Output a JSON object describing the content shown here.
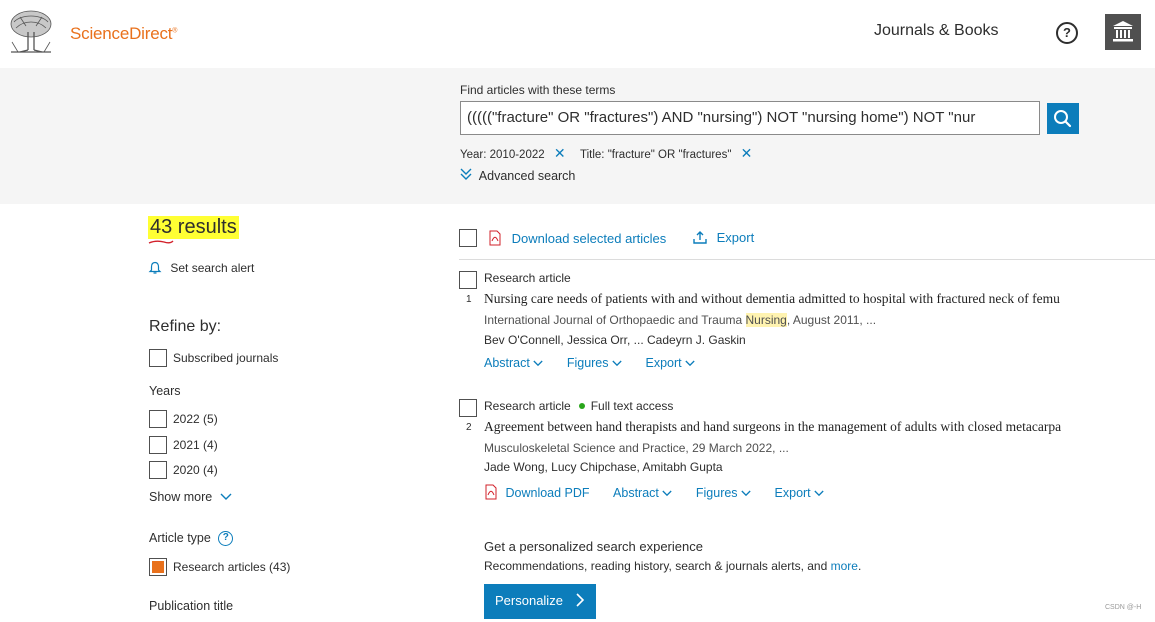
{
  "header": {
    "brand": "ScienceDirect",
    "brand_mark": "®",
    "journals_link": "Journals & Books",
    "help_icon_text": "?"
  },
  "search": {
    "find_label": "Find articles with these terms",
    "query": "(((((\"fracture\" OR \"fractures\") AND \"nursing\") NOT \"nursing home\") NOT \"nur",
    "chips": [
      {
        "label": "Year:",
        "value": "2010-2022"
      },
      {
        "label": "Title:",
        "value": "\"fracture\" OR \"fractures\""
      }
    ],
    "advanced_label": "Advanced search"
  },
  "sidebar": {
    "results_count": "43 results",
    "search_alert": "Set search alert",
    "refine_heading": "Refine by:",
    "subscribed": "Subscribed journals",
    "years_heading": "Years",
    "years": [
      "2022 (5)",
      "2021 (4)",
      "2020 (4)"
    ],
    "show_more": "Show more",
    "article_type_heading": "Article type",
    "article_types": [
      "Research articles (43)"
    ],
    "publication_title_heading": "Publication title"
  },
  "toolbar": {
    "download_selected": "Download selected articles",
    "export": "Export"
  },
  "results": [
    {
      "number": "1",
      "type": "Research article",
      "access": "",
      "title": "Nursing care needs of patients with and without dementia admitted to hospital with fractured neck of femu",
      "source_before": "International Journal of Orthopaedic and Trauma ",
      "source_highlight": "Nursing",
      "source_after": ", August 2011, ...",
      "authors": "Bev O'Connell, Jessica Orr, ... Cadeyrn J. Gaskin",
      "actions": [
        "Abstract",
        "Figures",
        "Export"
      ]
    },
    {
      "number": "2",
      "type": "Research article",
      "access": "Full text access",
      "title": "Agreement between hand therapists and hand surgeons in the management of adults with closed metacarpa",
      "source": "Musculoskeletal Science and Practice, 29 March 2022, ...",
      "authors": "Jade Wong, Lucy Chipchase, Amitabh Gupta",
      "download_pdf": "Download PDF",
      "actions": [
        "Abstract",
        "Figures",
        "Export"
      ]
    }
  ],
  "personalize": {
    "heading": "Get a personalized search experience",
    "text_before": "Recommendations, reading history, search & journals alerts, and ",
    "more_link": "more",
    "text_after": ".",
    "button": "Personalize"
  },
  "watermark": "CSDN @-H",
  "colors": {
    "brand_orange": "#e9711c",
    "link_blue": "#0c7dbb",
    "highlight_yellow": "#ffff33",
    "access_green": "#29a61b"
  }
}
